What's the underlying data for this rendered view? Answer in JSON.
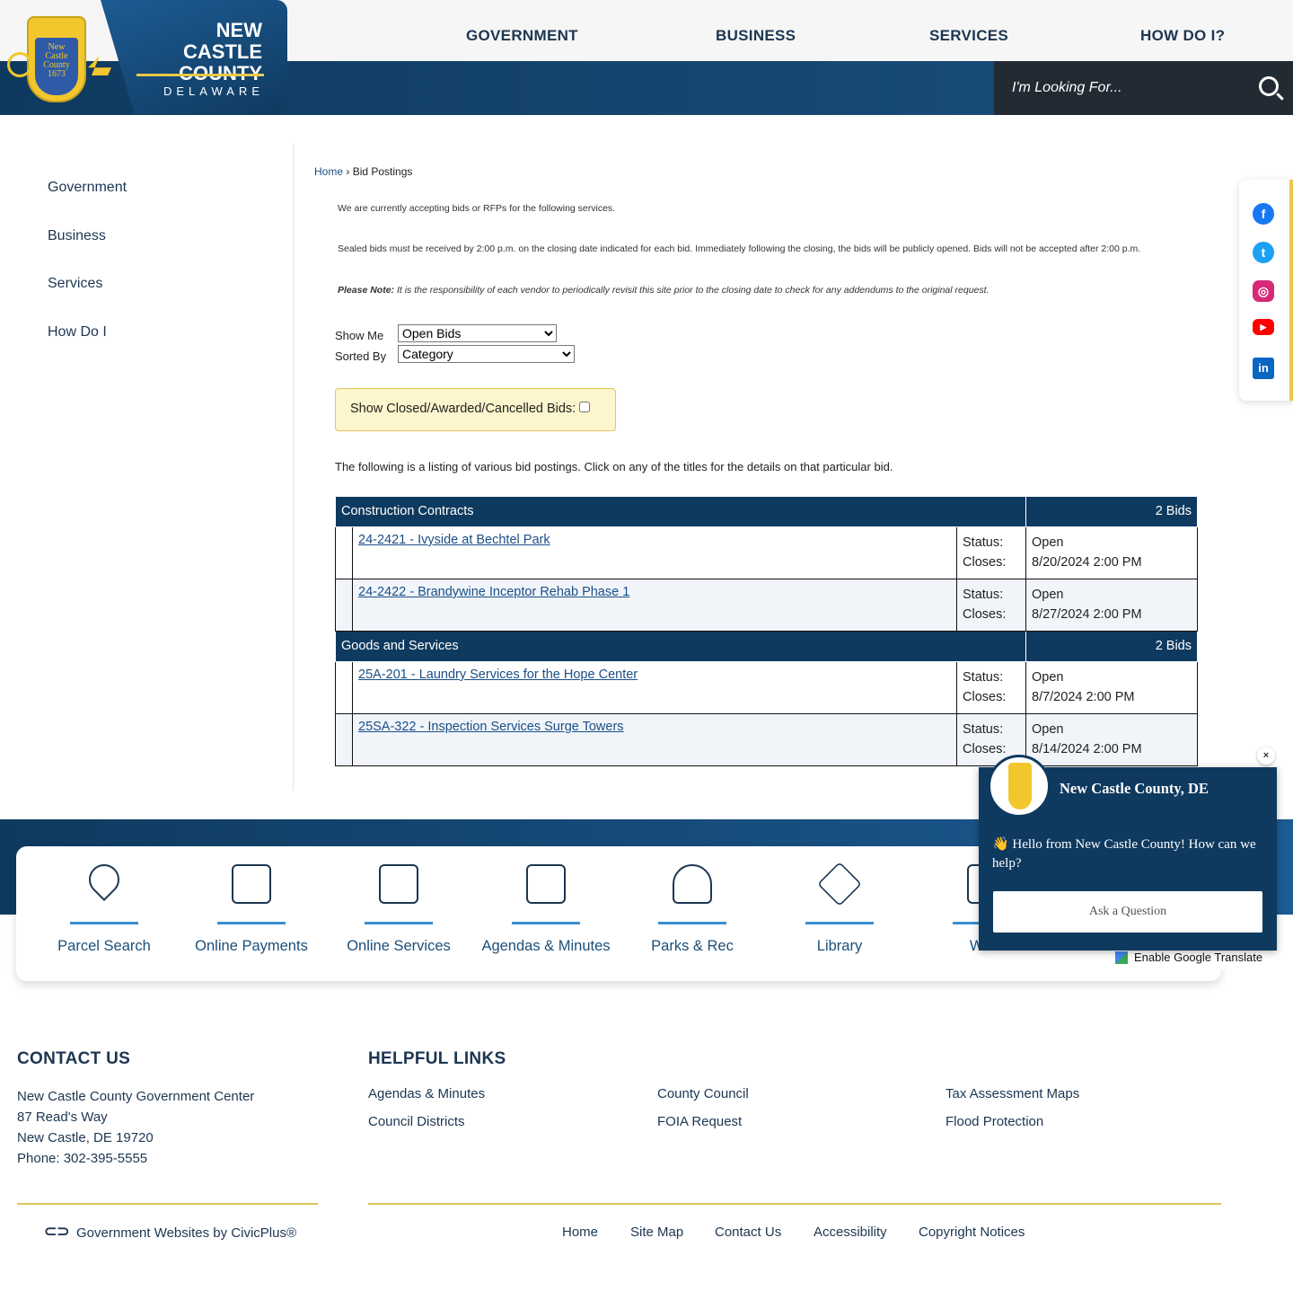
{
  "header": {
    "brand_line1": "NEW CASTLE",
    "brand_line2": "COUNTY",
    "brand_sub": "DELAWARE",
    "seal_text": "New Castle County 1673 Delaware",
    "nav": [
      "GOVERNMENT",
      "BUSINESS",
      "SERVICES",
      "HOW DO I?"
    ],
    "search_placeholder": "I'm Looking For..."
  },
  "sidebar": [
    "Government",
    "Business",
    "Services",
    "How Do I"
  ],
  "breadcrumb": {
    "home": "Home",
    "sep": "›",
    "current": "Bid Postings"
  },
  "intro": {
    "p1": "We are currently accepting bids or RFPs for the following services.",
    "p2": "Sealed bids must be received by 2:00 p.m. on the closing date indicated for each bid. Immediately following the closing, the bids will be publicly opened. Bids will not be accepted after 2:00 p.m.",
    "note_label": "Please Note:",
    "note": " It is the responsibility of each vendor to periodically revisit this site prior to the closing date to check for any addendums to the original request."
  },
  "filters": {
    "show_me_label": "Show Me",
    "show_me": "Open Bids",
    "sorted_by_label": "Sorted By",
    "sorted_by": "Category",
    "closed_label": "Show Closed/Awarded/Cancelled Bids:"
  },
  "listing_text": "The following is a listing of various bid postings. Click on any of the titles for the details on that particular bid.",
  "categories": [
    {
      "name": "Construction Contracts",
      "count": "2 Bids",
      "bids": [
        {
          "title": "24-2421 - Ivyside at Bechtel Park",
          "status": "Open",
          "closes": "8/20/2024 2:00 PM"
        },
        {
          "title": "24-2422 - Brandywine Inceptor Rehab Phase 1",
          "status": "Open",
          "closes": "8/27/2024 2:00 PM"
        }
      ]
    },
    {
      "name": "Goods and Services",
      "count": "2 Bids",
      "bids": [
        {
          "title": "25A-201 - Laundry Services for the Hope Center",
          "status": "Open",
          "closes": "8/7/2024 2:00 PM"
        },
        {
          "title": "25SA-322 - Inspection Services Surge Towers",
          "status": "Open",
          "closes": "8/14/2024 2:00 PM"
        }
      ]
    }
  ],
  "labels": {
    "status": "Status:",
    "closes": "Closes:"
  },
  "quick_links": [
    "Parcel Search",
    "Online Payments",
    "Online Services",
    "Agendas & Minutes",
    "Parks & Rec",
    "Library",
    "Work"
  ],
  "social": [
    "facebook",
    "twitter",
    "instagram",
    "youtube",
    "linkedin"
  ],
  "chat": {
    "title": "New Castle County, DE",
    "greeting": "👋 Hello from New Castle County! How can we help?",
    "button": "Ask a Question",
    "close": "×"
  },
  "google_translate": "Enable Google Translate",
  "contact": {
    "heading": "CONTACT US",
    "lines": [
      "New Castle County Government Center",
      "87 Read's Way",
      "New Castle, DE 19720",
      "Phone: 302-395-5555"
    ]
  },
  "helpful": {
    "heading": "HELPFUL LINKS",
    "links": [
      "Agendas & Minutes",
      "Council Districts",
      "County Council",
      "FOIA Request",
      "Tax Assessment Maps",
      "Flood Protection"
    ]
  },
  "bottom": {
    "civicplus": "Government Websites by CivicPlus®",
    "links": [
      "Home",
      "Site Map",
      "Contact Us",
      "Accessibility",
      "Copyright Notices"
    ]
  },
  "colors": {
    "primary": "#0f3a5f",
    "accent": "#e8c84a",
    "link": "#1a4f87"
  }
}
